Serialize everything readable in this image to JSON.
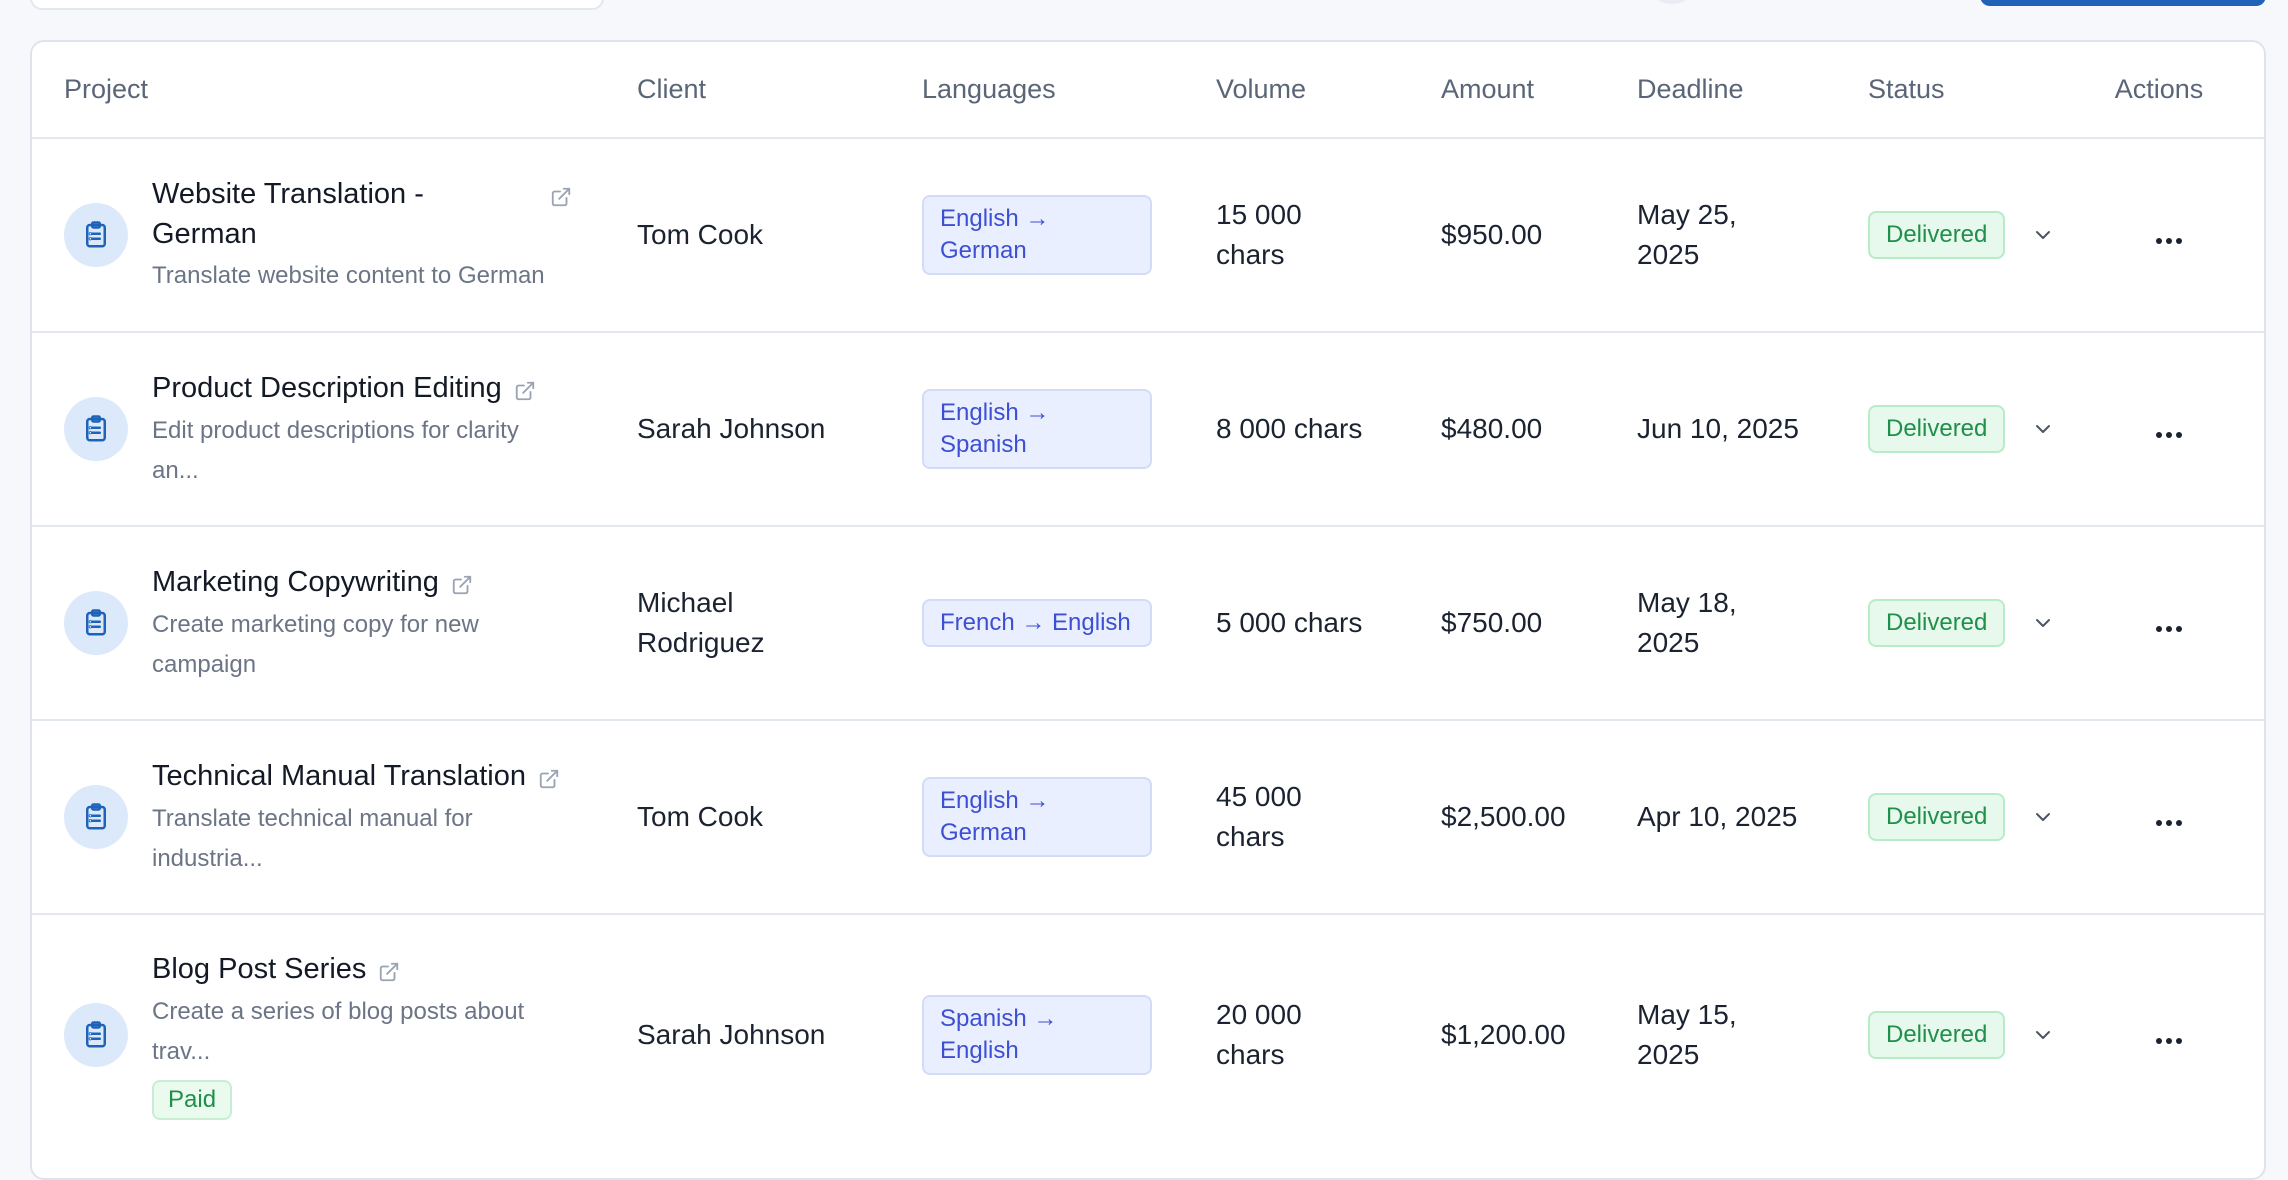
{
  "table": {
    "headers": {
      "project": "Project",
      "client": "Client",
      "languages": "Languages",
      "volume": "Volume",
      "amount": "Amount",
      "deadline": "Deadline",
      "status": "Status",
      "actions": "Actions"
    },
    "rows": [
      {
        "title": "Website Translation - German",
        "description": "Translate website content to German",
        "client": "Tom Cook",
        "languages": "English → German",
        "volume": "15 000 chars",
        "amount": "$950.00",
        "deadline": "May 25, 2025",
        "status": "Delivered"
      },
      {
        "title": "Product Description Editing",
        "description": "Edit product descriptions for clarity an...",
        "client": "Sarah Johnson",
        "languages": "English → Spanish",
        "volume": "8 000 chars",
        "amount": "$480.00",
        "deadline": "Jun 10, 2025",
        "status": "Delivered"
      },
      {
        "title": "Marketing Copywriting",
        "description": "Create marketing copy for new campaign",
        "client": "Michael Rodriguez",
        "languages": "French → English",
        "volume": "5 000 chars",
        "amount": "$750.00",
        "deadline": "May 18, 2025",
        "status": "Delivered"
      },
      {
        "title": "Technical Manual Translation",
        "description": "Translate technical manual for industria...",
        "client": "Tom Cook",
        "languages": "English → German",
        "volume": "45 000 chars",
        "amount": "$2,500.00",
        "deadline": "Apr 10, 2025",
        "status": "Delivered"
      },
      {
        "title": "Blog Post Series",
        "description": "Create a series of blog posts about trav...",
        "payment_badge": "Paid",
        "client": "Sarah Johnson",
        "languages": "Spanish → English",
        "volume": "20 000 chars",
        "amount": "$1,200.00",
        "deadline": "May 15, 2025",
        "status": "Delivered"
      }
    ]
  },
  "icons": {
    "project": "clipboard-icon",
    "external_link": "external-link-icon",
    "status_menu": "chevron-down-icon",
    "row_actions": "more-horizontal-icon"
  },
  "colors": {
    "accent": "#1e63b8",
    "status_delivered_text": "#1f8f4a",
    "status_delivered_bg": "#e6f9ec",
    "language_badge_text": "#3d4fd2",
    "language_badge_bg": "#eaefff"
  }
}
